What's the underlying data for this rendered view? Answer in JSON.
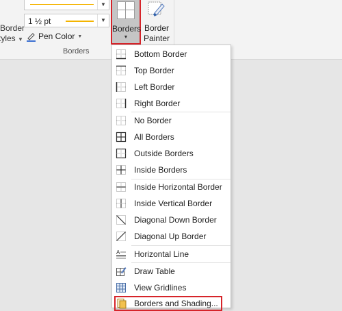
{
  "ribbon": {
    "border_styles_line1": "Border",
    "border_styles_line2": "Styles",
    "line_weight": "1 ½ pt",
    "pen_color": "Pen Color",
    "group_label": "Borders",
    "borders_button": "Borders",
    "painter_line1": "Border",
    "painter_line2": "Painter"
  },
  "colors": {
    "accent_line": "#f4b400",
    "highlight_outline": "#d6242a",
    "pen_color_swatch": "#3b6fd1"
  },
  "menu": {
    "items": [
      {
        "label": "Bottom Border",
        "icon": "bottom-border-icon"
      },
      {
        "label": "Top Border",
        "icon": "top-border-icon"
      },
      {
        "label": "Left Border",
        "icon": "left-border-icon"
      },
      {
        "label": "Right Border",
        "icon": "right-border-icon"
      },
      {
        "label": "No Border",
        "icon": "no-border-icon"
      },
      {
        "label": "All Borders",
        "icon": "all-borders-icon"
      },
      {
        "label": "Outside Borders",
        "icon": "outside-borders-icon"
      },
      {
        "label": "Inside Borders",
        "icon": "inside-borders-icon"
      },
      {
        "label": "Inside Horizontal Border",
        "icon": "inside-horizontal-border-icon"
      },
      {
        "label": "Inside Vertical Border",
        "icon": "inside-vertical-border-icon"
      },
      {
        "label": "Diagonal Down Border",
        "icon": "diagonal-down-border-icon"
      },
      {
        "label": "Diagonal Up Border",
        "icon": "diagonal-up-border-icon"
      },
      {
        "label": "Horizontal Line",
        "icon": "horizontal-line-icon"
      },
      {
        "label": "Draw Table",
        "icon": "draw-table-icon"
      },
      {
        "label": "View Gridlines",
        "icon": "view-gridlines-icon"
      },
      {
        "label": "Borders and Shading...",
        "icon": "borders-and-shading-icon"
      }
    ]
  }
}
